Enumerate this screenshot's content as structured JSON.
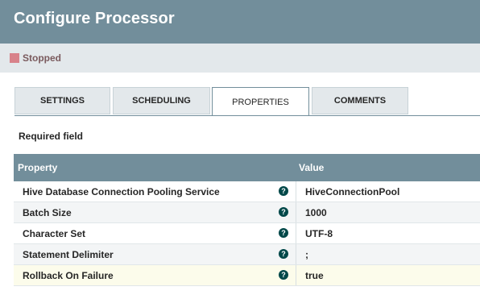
{
  "dialog": {
    "title": "Configure Processor"
  },
  "status": {
    "label": "Stopped",
    "color": "#d8828a"
  },
  "tabs": [
    {
      "label": "SETTINGS",
      "active": false
    },
    {
      "label": "SCHEDULING",
      "active": false
    },
    {
      "label": "PROPERTIES",
      "active": true
    },
    {
      "label": "COMMENTS",
      "active": false
    }
  ],
  "properties": {
    "required_label": "Required field",
    "columns": {
      "property": "Property",
      "value": "Value"
    },
    "help_icon": "question-circle-icon",
    "rows": [
      {
        "name": "Hive Database Connection Pooling Service",
        "value": "HiveConnectionPool"
      },
      {
        "name": "Batch Size",
        "value": "1000"
      },
      {
        "name": "Character Set",
        "value": "UTF-8"
      },
      {
        "name": "Statement Delimiter",
        "value": ";"
      },
      {
        "name": "Rollback On Failure",
        "value": "true"
      }
    ]
  },
  "colors": {
    "header": "#728e9b",
    "help_icon": "#004849"
  }
}
